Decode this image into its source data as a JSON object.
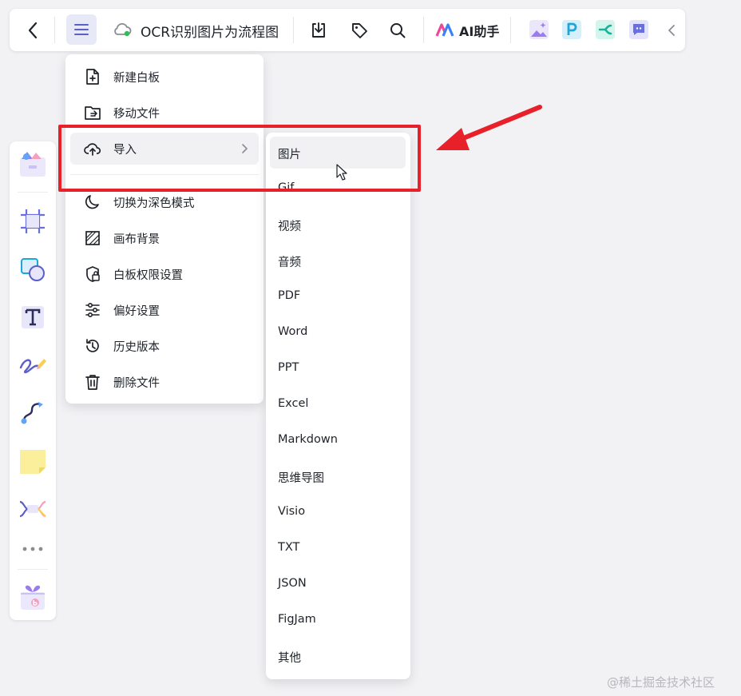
{
  "toolbar": {
    "title": "OCR识别图片为流程图",
    "ai_label": "AI助手",
    "icons": [
      "back-icon",
      "menu-icon",
      "cloud-sync-icon",
      "download-icon",
      "tag-icon",
      "search-icon",
      "ai-logo-icon",
      "image-app-icon",
      "p-app-icon",
      "mindmap-app-icon",
      "chat-app-icon",
      "collapse-icon"
    ]
  },
  "left_tools": [
    "template-icon",
    "frame-icon",
    "shape-icon",
    "text-icon",
    "pen-icon",
    "connector-icon",
    "sticky-note-icon",
    "mindmap-icon",
    "more-icon",
    "gift-icon"
  ],
  "menu": {
    "items": [
      {
        "label": "新建白板",
        "icon": "new-board-icon"
      },
      {
        "label": "移动文件",
        "icon": "move-folder-icon"
      },
      {
        "label": "导入",
        "icon": "upload-cloud-icon"
      },
      {
        "label": "切换为深色模式",
        "icon": "moon-icon"
      },
      {
        "label": "画布背景",
        "icon": "canvas-background-icon"
      },
      {
        "label": "白板权限设置",
        "icon": "permission-icon"
      },
      {
        "label": "偏好设置",
        "icon": "sliders-icon"
      },
      {
        "label": "历史版本",
        "icon": "history-icon"
      },
      {
        "label": "删除文件",
        "icon": "trash-icon"
      }
    ]
  },
  "submenu": {
    "items": [
      "图片",
      "Gif",
      "视频",
      "音频",
      "PDF",
      "Word",
      "PPT",
      "Excel",
      "Markdown",
      "思维导图",
      "Visio",
      "TXT",
      "JSON",
      "FigJam",
      "其他"
    ]
  },
  "colors": {
    "highlight": "#e8202a",
    "accent": "#5b5fc7",
    "background": "#f2f2f5"
  },
  "watermark": "@稀土掘金技术社区"
}
